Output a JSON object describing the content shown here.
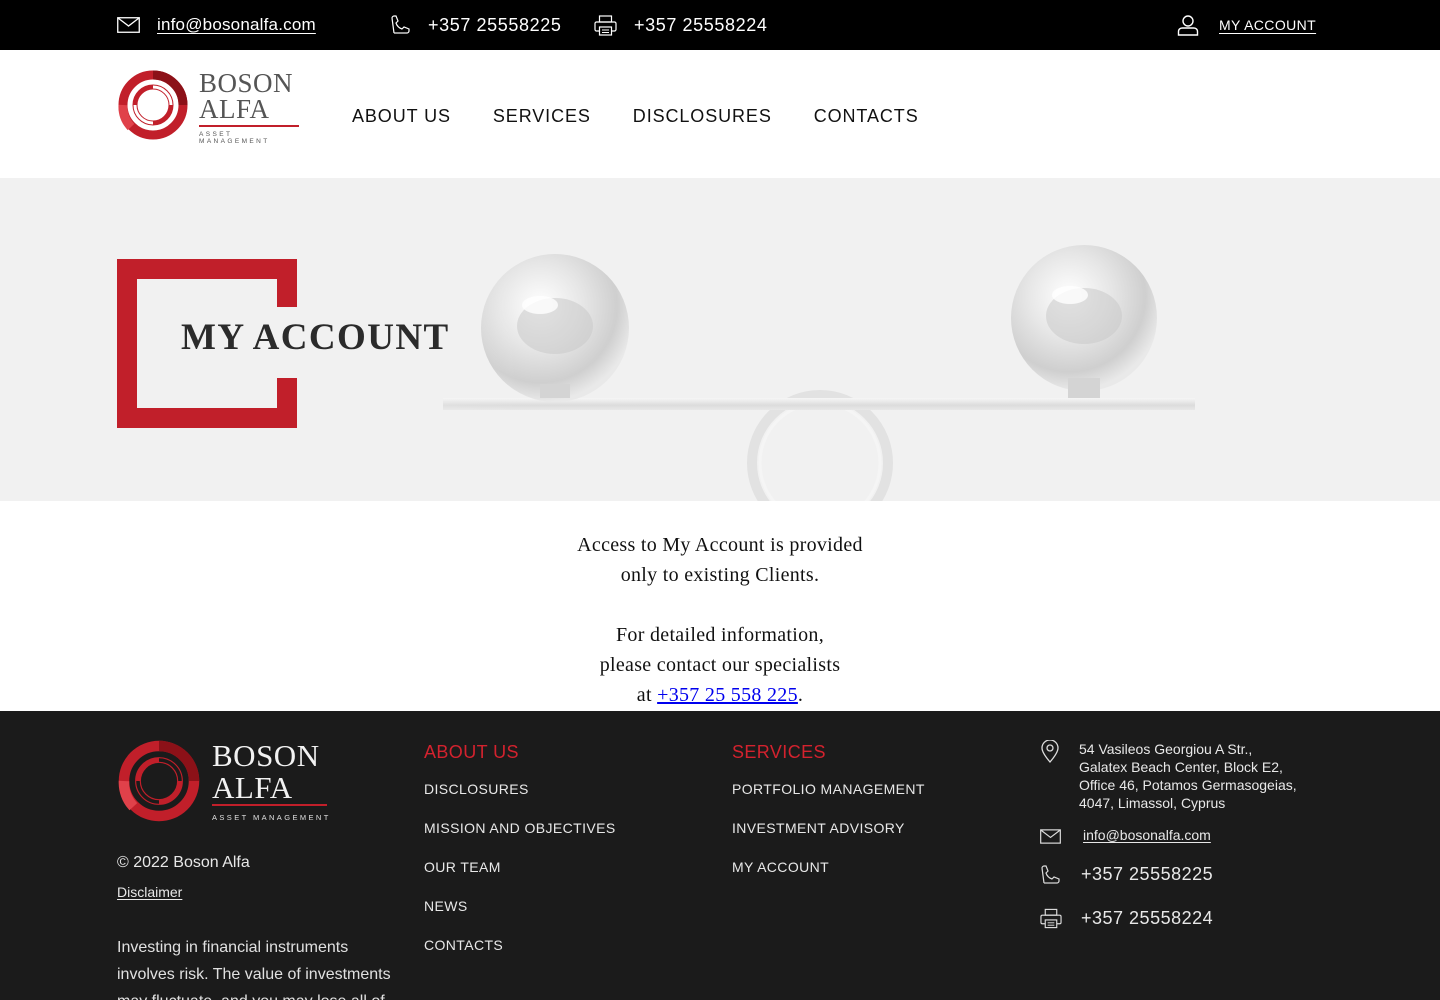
{
  "topbar": {
    "email": "info@bosonalfa.com",
    "phone": "+357 25558225",
    "fax": "+357 25558224",
    "account_label": "MY ACCOUNT",
    "icons": {
      "email": "envelope-icon",
      "phone": "phone-icon",
      "fax": "fax-icon",
      "account": "user-icon"
    }
  },
  "brand": {
    "line1": "BOSON",
    "line2": "ALFA",
    "tagline": "ASSET MANAGEMENT",
    "accent": "#c11f2a"
  },
  "nav": {
    "items": [
      {
        "label": "ABOUT US"
      },
      {
        "label": "SERVICES"
      },
      {
        "label": "DISCLOSURES"
      },
      {
        "label": "CONTACTS"
      }
    ]
  },
  "hero": {
    "title": "MY ACCOUNT"
  },
  "content": {
    "line1": "Access to My Account is provided",
    "line2": "only to existing Clients.",
    "line3": "For detailed information,",
    "line4": "please contact our specialists",
    "line5_prefix": "at ",
    "phone_link": "+357 25 558 225",
    "line5_suffix": "."
  },
  "footer": {
    "copyright": "© 2022  Boson Alfa",
    "disclaimer": "Disclaimer",
    "risk_text": "Investing in financial instruments involves risk. The value of investments may fluctuate, and you may lose all of",
    "about": {
      "title": "ABOUT US",
      "items": [
        {
          "label": "DISCLOSURES"
        },
        {
          "label": "MISSION AND OBJECTIVES"
        },
        {
          "label": "OUR TEAM"
        },
        {
          "label": "NEWS"
        },
        {
          "label": "CONTACTS"
        }
      ]
    },
    "services": {
      "title": "SERVICES",
      "items": [
        {
          "label": "PORTFOLIO MANAGEMENT"
        },
        {
          "label": "INVESTMENT ADVISORY"
        },
        {
          "label": "MY ACCOUNT"
        }
      ]
    },
    "address": {
      "line1": "54 Vasileos Georgiou A Str.,",
      "line2": "Galatex Beach Center, Block E2,",
      "line3": "Office 46, Potamos Germasogeias,",
      "line4": "4047, Limassol, Cyprus"
    },
    "email": "info@bosonalfa.com",
    "phone": "+357 25558225",
    "fax": "+357 25558224",
    "icons": {
      "location": "location-pin-icon",
      "email": "envelope-icon",
      "phone": "phone-icon",
      "fax": "fax-icon"
    },
    "title_color": "#d3222e"
  }
}
